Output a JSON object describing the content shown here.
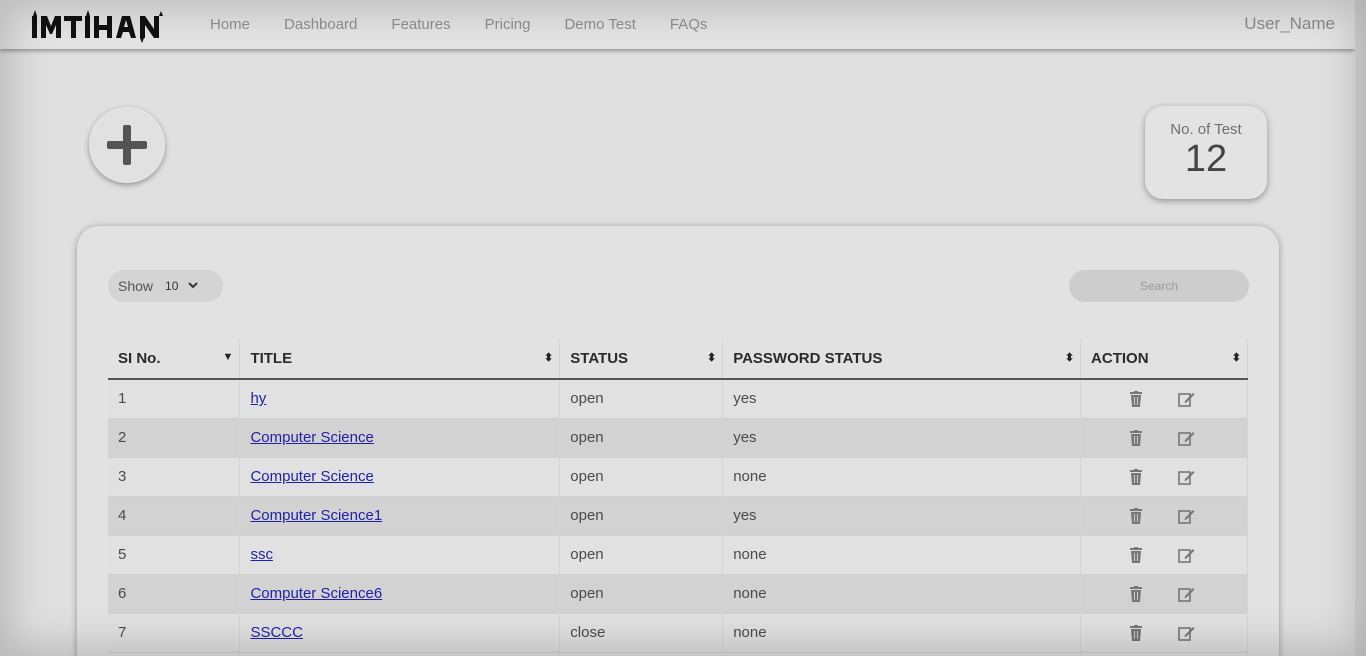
{
  "brand": {
    "logo_text": "IMTIHAN"
  },
  "nav": {
    "links": [
      "Home",
      "Dashboard",
      "Features",
      "Pricing",
      "Demo Test",
      "FAQs"
    ],
    "user_name": "User_Name"
  },
  "stats": {
    "label": "No. of Test",
    "value": "12"
  },
  "controls": {
    "show_label": "Show",
    "show_value": "10",
    "search_placeholder": "Search"
  },
  "table": {
    "headers": [
      "SI No.",
      "TITLE",
      "STATUS",
      "PASSWORD STATUS",
      "ACTION"
    ],
    "rows": [
      {
        "sl": "1",
        "title": "hy",
        "status": "open",
        "password": "yes"
      },
      {
        "sl": "2",
        "title": "Computer Science",
        "status": "open",
        "password": "yes"
      },
      {
        "sl": "3",
        "title": "Computer Science",
        "status": "open",
        "password": "none"
      },
      {
        "sl": "4",
        "title": "Computer Science1",
        "status": "open",
        "password": "yes"
      },
      {
        "sl": "5",
        "title": "ssc",
        "status": "open",
        "password": "none"
      },
      {
        "sl": "6",
        "title": "Computer Science6",
        "status": "open",
        "password": "none"
      },
      {
        "sl": "7",
        "title": "SSCCC",
        "status": "close",
        "password": "none"
      }
    ]
  }
}
